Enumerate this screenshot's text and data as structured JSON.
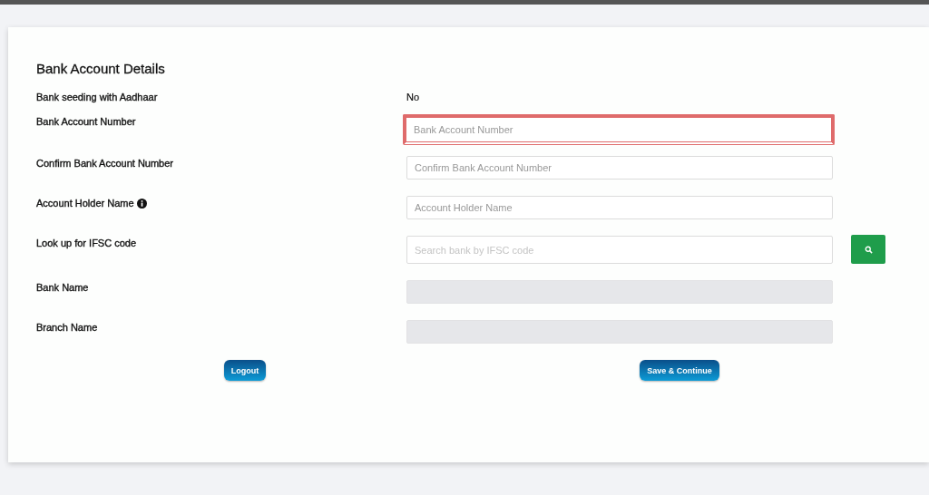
{
  "section": {
    "title": "Bank Account Details"
  },
  "rows": [
    {
      "kind": "value",
      "label": "Bank seeding with Aadhaar",
      "value": "No"
    },
    {
      "kind": "input",
      "label": "Bank Account Number",
      "placeholder": "Bank Account Number",
      "focused": true,
      "disabled": false
    },
    {
      "kind": "input",
      "label": "Confirm Bank Account Number",
      "placeholder": "Confirm Bank Account Number",
      "focused": false,
      "disabled": false
    },
    {
      "kind": "input",
      "label": "Account Holder Name",
      "info": true,
      "placeholder": "Account Holder Name",
      "focused": false,
      "disabled": false
    },
    {
      "kind": "search",
      "label": "Look up for IFSC code",
      "placeholder": "Search bank by IFSC code",
      "focused": false,
      "disabled": false
    },
    {
      "kind": "input",
      "label": "Bank Name",
      "focused": false,
      "disabled": true
    },
    {
      "kind": "input",
      "label": "Branch Name",
      "focused": false,
      "disabled": true
    }
  ],
  "buttons": [
    "Logout",
    "Save & Continue"
  ]
}
